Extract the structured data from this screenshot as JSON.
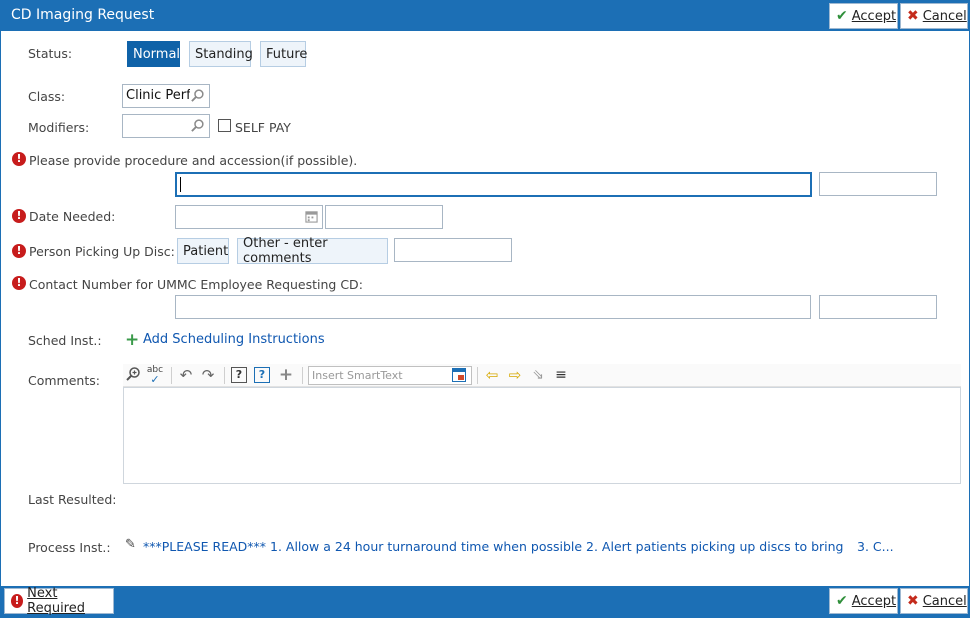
{
  "window": {
    "title": "CD Imaging Request",
    "accept_label": "Accept",
    "cancel_label": "Cancel"
  },
  "status": {
    "label": "Status:",
    "options": [
      "Normal",
      "Standing",
      "Future"
    ],
    "selected": "Normal"
  },
  "class": {
    "label": "Class:",
    "value": "Clinic Perfo"
  },
  "modifiers": {
    "label": "Modifiers:",
    "value": "",
    "self_pay_label": "SELF PAY",
    "self_pay_checked": false
  },
  "procedure": {
    "label": "Please provide procedure and accession(if possible).",
    "value": ""
  },
  "date_needed": {
    "label": "Date Needed:",
    "value": ""
  },
  "person_picking": {
    "label": "Person Picking Up Disc:",
    "options": [
      "Patient",
      "Other - enter comments"
    ]
  },
  "contact": {
    "label": "Contact Number for UMMC Employee Requesting CD:",
    "value": ""
  },
  "sched_inst": {
    "label": "Sched Inst.:",
    "link": "Add Scheduling Instructions"
  },
  "comments": {
    "label": "Comments:",
    "smarttext_placeholder": "Insert SmartText",
    "value": ""
  },
  "last_resulted": {
    "label": "Last Resulted:"
  },
  "process_inst": {
    "label": "Process Inst.:",
    "text": "***PLEASE READ*** 1. Allow a 24 hour turnaround time when possible 2. Alert patients picking up discs to bring an ID!",
    "text_more": "3. C..."
  },
  "footer": {
    "next_required_label": "Next Required",
    "accept_label": "Accept",
    "cancel_label": "Cancel"
  },
  "colors": {
    "accent": "#1c6fb5",
    "selected": "#0f62a8",
    "required": "#c71c1c",
    "link": "#0f57b0"
  }
}
